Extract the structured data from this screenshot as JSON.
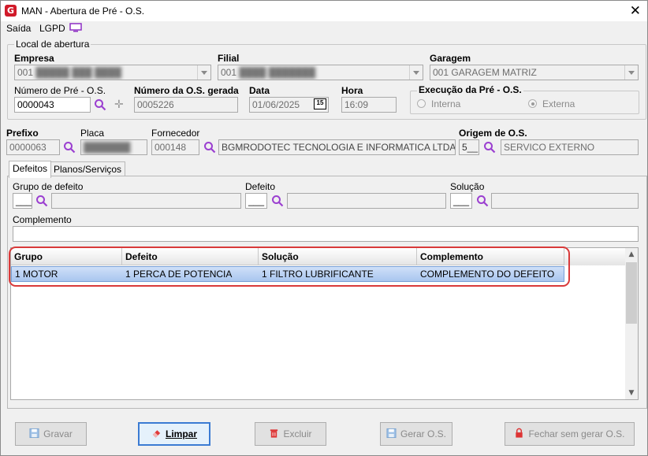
{
  "window": {
    "title": "MAN - Abertura de Pré - O.S.",
    "logo_letter": "G",
    "close_glyph": "✕"
  },
  "menu": {
    "saida": "Saída",
    "lgpd": "LGPD",
    "lgpd_icon": "monitor-icon"
  },
  "local_abertura": {
    "title": "Local de abertura",
    "empresa_label": "Empresa",
    "empresa_value": "001",
    "filial_label": "Filial",
    "filial_value": "001",
    "garagem_label": "Garagem",
    "garagem_value": "001 GARAGEM MATRIZ",
    "numero_pre_os_label": "Número de Pré - O.S.",
    "numero_pre_os_value": "0000043",
    "numero_os_gerada_label": "Número da O.S. gerada",
    "numero_os_gerada_value": "0005226",
    "data_label": "Data",
    "data_value": "01/06/2025",
    "calendar_icon_text": "15",
    "hora_label": "Hora",
    "hora_value": "16:09",
    "execucao_title": "Execução da Pré - O.S.",
    "interna_label": "Interna",
    "externa_label": "Externa",
    "selected": "Externa"
  },
  "vehicle": {
    "prefixo_label": "Prefixo",
    "prefixo_value": "0000063",
    "placa_label": "Placa",
    "fornecedor_label": "Fornecedor",
    "fornecedor_code": "000148",
    "fornecedor_name": "BGMRODOTEC TECNOLOGIA E INFORMATICA LTDA",
    "origem_label": "Origem de O.S.",
    "origem_code": "5__",
    "origem_name": "SERVICO EXTERNO"
  },
  "tabs": [
    {
      "label": "Defeitos",
      "active": true
    },
    {
      "label": "Planos/Serviços",
      "active": false
    }
  ],
  "defeitos": {
    "grupo_label": "Grupo de defeito",
    "grupo_code": "___",
    "defeito_label": "Defeito",
    "defeito_code": "___",
    "solucao_label": "Solução",
    "solucao_code": "___",
    "complemento_label": "Complemento",
    "complemento_value": ""
  },
  "grid": {
    "columns": [
      "Grupo",
      "Defeito",
      "Solução",
      "Complemento"
    ],
    "rows": [
      [
        "1 MOTOR",
        "1 PERCA DE POTENCIA",
        "1 FILTRO LUBRIFICANTE",
        "COMPLEMENTO DO DEFEITO"
      ]
    ]
  },
  "buttons": {
    "gravar": "Gravar",
    "limpar": "Limpar",
    "excluir": "Excluir",
    "gerar_os": "Gerar O.S.",
    "fechar": "Fechar sem gerar O.S."
  },
  "colors": {
    "highlight": "#d93a3a",
    "selection": "#a9c6ef",
    "search_icon": "#9b3fd0",
    "primary_button_border": "#3b7bd3"
  }
}
